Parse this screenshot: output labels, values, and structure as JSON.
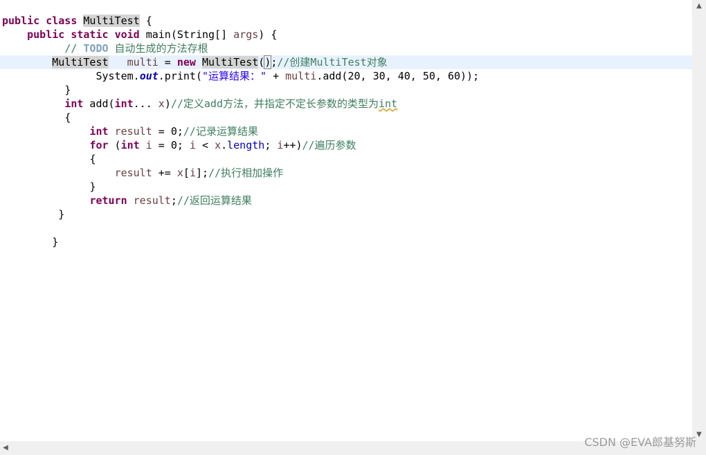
{
  "editor": {
    "lines": [
      {
        "indent": "",
        "parts": [
          {
            "t": "public",
            "c": "kw"
          },
          {
            "t": " ",
            "c": ""
          },
          {
            "t": "class",
            "c": "kw"
          },
          {
            "t": " ",
            "c": ""
          },
          {
            "t": "MultiTest",
            "c": "mark"
          },
          {
            "t": " {",
            "c": ""
          }
        ]
      },
      {
        "indent": "    ",
        "parts": [
          {
            "t": "public",
            "c": "kw"
          },
          {
            "t": " ",
            "c": ""
          },
          {
            "t": "static",
            "c": "kw"
          },
          {
            "t": " ",
            "c": ""
          },
          {
            "t": "void",
            "c": "kw"
          },
          {
            "t": " main(String[] ",
            "c": ""
          },
          {
            "t": "args",
            "c": "var"
          },
          {
            "t": ") {",
            "c": ""
          }
        ]
      },
      {
        "indent": "          ",
        "parts": [
          {
            "t": "// ",
            "c": "cm"
          },
          {
            "t": "TODO",
            "c": "todo"
          },
          {
            "t": " 自动生成的方法存根",
            "c": "cm"
          }
        ]
      },
      {
        "indent": "        ",
        "current": true,
        "parts": [
          {
            "t": "MultiTest",
            "c": "mark"
          },
          {
            "t": "   ",
            "c": ""
          },
          {
            "t": "multi",
            "c": "var"
          },
          {
            "t": " = ",
            "c": ""
          },
          {
            "t": "new",
            "c": "kw"
          },
          {
            "t": " ",
            "c": ""
          },
          {
            "t": "MultiTest",
            "c": "mark"
          },
          {
            "t": "(",
            "c": ""
          },
          {
            "t": ")",
            "c": "bracket"
          },
          {
            "t": ";",
            "c": ""
          },
          {
            "t": "//创建MultiTest对象",
            "c": "cm"
          }
        ]
      },
      {
        "indent": "               ",
        "parts": [
          {
            "t": "System.",
            "c": ""
          },
          {
            "t": "out",
            "c": "sfld"
          },
          {
            "t": ".print(",
            "c": ""
          },
          {
            "t": "\"运算结果：\"",
            "c": "str"
          },
          {
            "t": " + ",
            "c": ""
          },
          {
            "t": "multi",
            "c": "var"
          },
          {
            "t": ".add(20, 30, 40, 50, 60));",
            "c": ""
          }
        ]
      },
      {
        "indent": "          ",
        "parts": [
          {
            "t": "}",
            "c": ""
          }
        ]
      },
      {
        "indent": "          ",
        "parts": [
          {
            "t": "int",
            "c": "kw"
          },
          {
            "t": " add(",
            "c": ""
          },
          {
            "t": "int",
            "c": "kw"
          },
          {
            "t": "... ",
            "c": ""
          },
          {
            "t": "x",
            "c": "var"
          },
          {
            "t": ")",
            "c": ""
          },
          {
            "t": "//定义add方法，并指定不定长参数的类型为",
            "c": "cm"
          },
          {
            "t": "int",
            "c": "cm squiggle"
          }
        ]
      },
      {
        "indent": "          ",
        "parts": [
          {
            "t": "{",
            "c": ""
          }
        ]
      },
      {
        "indent": "              ",
        "parts": [
          {
            "t": "int",
            "c": "kw"
          },
          {
            "t": " ",
            "c": ""
          },
          {
            "t": "result",
            "c": "var"
          },
          {
            "t": " = 0;",
            "c": ""
          },
          {
            "t": "//记录运算结果",
            "c": "cm"
          }
        ]
      },
      {
        "indent": "              ",
        "parts": [
          {
            "t": "for",
            "c": "kw"
          },
          {
            "t": " (",
            "c": ""
          },
          {
            "t": "int",
            "c": "kw"
          },
          {
            "t": " ",
            "c": ""
          },
          {
            "t": "i",
            "c": "var"
          },
          {
            "t": " = 0; ",
            "c": ""
          },
          {
            "t": "i",
            "c": "var"
          },
          {
            "t": " < ",
            "c": ""
          },
          {
            "t": "x",
            "c": "var"
          },
          {
            "t": ".",
            "c": ""
          },
          {
            "t": "length",
            "c": "fld"
          },
          {
            "t": "; ",
            "c": ""
          },
          {
            "t": "i",
            "c": "var"
          },
          {
            "t": "++)",
            "c": ""
          },
          {
            "t": "//遍历参数",
            "c": "cm"
          }
        ]
      },
      {
        "indent": "              ",
        "parts": [
          {
            "t": "{",
            "c": ""
          }
        ]
      },
      {
        "indent": "                  ",
        "parts": [
          {
            "t": "result",
            "c": "var"
          },
          {
            "t": " += ",
            "c": ""
          },
          {
            "t": "x",
            "c": "var"
          },
          {
            "t": "[",
            "c": ""
          },
          {
            "t": "i",
            "c": "var"
          },
          {
            "t": "];",
            "c": ""
          },
          {
            "t": "//执行相加操作",
            "c": "cm"
          }
        ]
      },
      {
        "indent": "              ",
        "parts": [
          {
            "t": "}",
            "c": ""
          }
        ]
      },
      {
        "indent": "              ",
        "parts": [
          {
            "t": "return",
            "c": "kw"
          },
          {
            "t": " ",
            "c": ""
          },
          {
            "t": "result",
            "c": "var"
          },
          {
            "t": ";",
            "c": ""
          },
          {
            "t": "//返回运算结果",
            "c": "cm"
          }
        ]
      },
      {
        "indent": "         ",
        "parts": [
          {
            "t": "}",
            "c": ""
          }
        ]
      },
      {
        "indent": "",
        "parts": []
      },
      {
        "indent": "        ",
        "parts": [
          {
            "t": "}",
            "c": ""
          }
        ]
      }
    ]
  },
  "scrollbars": {
    "up_icon": "▲",
    "down_icon": "▼",
    "left_icon": "◀"
  },
  "watermark": "CSDN @EVA郎基努斯"
}
